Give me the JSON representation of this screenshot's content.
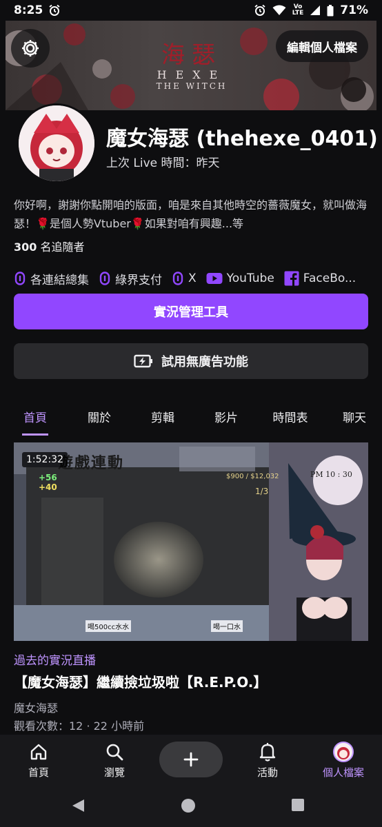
{
  "status_bar": {
    "time": "8:25",
    "battery": "71%",
    "network_label": "LTE"
  },
  "banner": {
    "logo_cjk": "海瑟",
    "logo_hexe": "HEXE",
    "logo_witch": "THE WITCH",
    "edit_profile_label": "編輯個人檔案"
  },
  "profile": {
    "channel_name": "魔女海瑟 (thehexe_0401)",
    "last_live": "上次 Live 時間：昨天",
    "bio": "你好啊，謝謝你點開咱的版面，咱是來自其他時空的薔薇魔女，就叫做海瑟！🌹是個人勢Vtuber🌹如果對咱有興趣...等",
    "followers_count": "300",
    "followers_label": "名追隨者"
  },
  "links": [
    {
      "icon": "twitch-icon",
      "label": "各連結總集"
    },
    {
      "icon": "twitch-icon",
      "label": "綠界支付"
    },
    {
      "icon": "twitch-icon",
      "label": "X"
    },
    {
      "icon": "youtube-icon",
      "label": "YouTube"
    },
    {
      "icon": "facebook-icon",
      "label": "FaceBo..."
    }
  ],
  "buttons": {
    "stream_manager": "實況管理工具",
    "ad_free_trial": "試用無廣告功能"
  },
  "tabs": [
    {
      "label": "首頁",
      "active": true
    },
    {
      "label": "關於",
      "active": false
    },
    {
      "label": "剪輯",
      "active": false
    },
    {
      "label": "影片",
      "active": false
    },
    {
      "label": "時間表",
      "active": false
    },
    {
      "label": "聊天",
      "active": false
    }
  ],
  "video": {
    "duration": "1:52:32",
    "category": "過去的實況直播",
    "title": "【魔女海瑟】繼續撿垃圾啦【R.E.P.O.】",
    "channel": "魔女海瑟",
    "meta": "觀看次數：12 · 22 小時前",
    "overlay_title": "遊戲連動",
    "overlay_time": "PM 10 : 30",
    "hud_money": "$900 / $12,032",
    "hud_count": "1/3",
    "hud_plus": "+56",
    "hud_bolt": "+40",
    "chat_1": "喝500cc水水",
    "chat_2": "喝一口水"
  },
  "bottom_nav": [
    {
      "icon": "home-icon",
      "label": "首頁"
    },
    {
      "icon": "search-icon",
      "label": "瀏覽"
    },
    {
      "icon": "bell-icon",
      "label": "活動"
    },
    {
      "icon": "profile-avatar-icon",
      "label": "個人檔案"
    }
  ],
  "colors": {
    "background": "#0e0e10",
    "accent": "#9147ff",
    "accent_text": "#bf94ff",
    "secondary_button": "#2a2a2d",
    "youtube": "#9147ff",
    "facebook": "#9147ff"
  }
}
